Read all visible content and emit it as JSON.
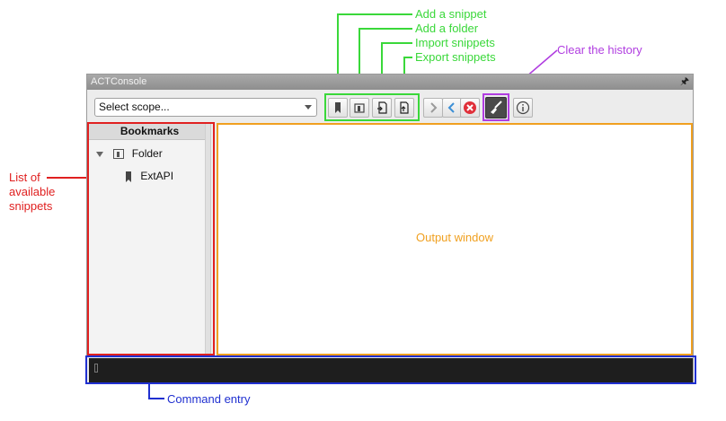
{
  "window": {
    "title": "ACTConsole",
    "pin_glyph": "†"
  },
  "toolbar": {
    "scope_placeholder": "Select scope...",
    "buttons": [
      {
        "id": "add-snippet",
        "icon": "bookmark-icon"
      },
      {
        "id": "add-folder",
        "icon": "folder-icon"
      },
      {
        "id": "import-snippets",
        "icon": "import-icon"
      },
      {
        "id": "export-snippets",
        "icon": "export-icon"
      },
      {
        "id": "forward",
        "icon": "chevron-right-icon"
      },
      {
        "id": "back",
        "icon": "chevron-left-icon"
      },
      {
        "id": "stop",
        "icon": "stop-icon"
      },
      {
        "id": "clear-history",
        "icon": "broom-icon"
      },
      {
        "id": "info",
        "icon": "info-icon"
      }
    ]
  },
  "bookmarks": {
    "header": "Bookmarks",
    "folder": "Folder",
    "item": "ExtAPI"
  },
  "output": {
    "label": "Output window"
  },
  "annotations": {
    "add_snippet": "Add a snippet",
    "add_folder": "Add a folder",
    "import_snippets": "Import snippets",
    "export_snippets": "Export snippets",
    "clear_history": "Clear the history",
    "list_line1": "List of",
    "list_line2": "available",
    "list_line3": "snippets",
    "command_entry": "Command entry"
  },
  "colors": {
    "green": "#3ad83a",
    "purple": "#b03de0",
    "red": "#e02020",
    "orange": "#f0a020",
    "blue": "#2030d0"
  }
}
